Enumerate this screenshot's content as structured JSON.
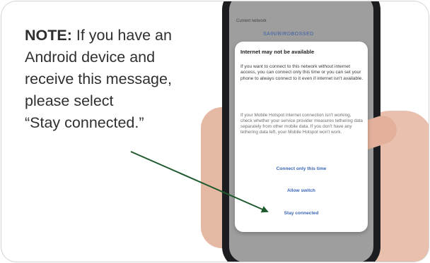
{
  "note": {
    "label": "NOTE:",
    "lines": [
      " If you have an",
      "Android device and",
      "receive this message,",
      "please select",
      "“Stay connected.”"
    ]
  },
  "phone": {
    "background": {
      "current_network_label": "Current network",
      "ssid": "SAIN/BIRDBOSSED"
    },
    "dialog": {
      "title": "Internet may not be available",
      "body": "If you want to connect to this network without internet access, you can connect only this time or you can set your phone to always connect to it even if internet isn't available.",
      "detail": "If your Mobile Hotspot internet connection isn't working, check whether your service provider measures tethering data separately from other mobile data. If you don't have any tethering data left, your Mobile Hotspot won't work.",
      "buttons": [
        "Connect only this time",
        "Allow switch",
        "Stay connected"
      ]
    }
  },
  "colors": {
    "arrow": "#1f5a2e",
    "dialog_button": "#3a66b6",
    "note_text": "#2f2f2f"
  }
}
